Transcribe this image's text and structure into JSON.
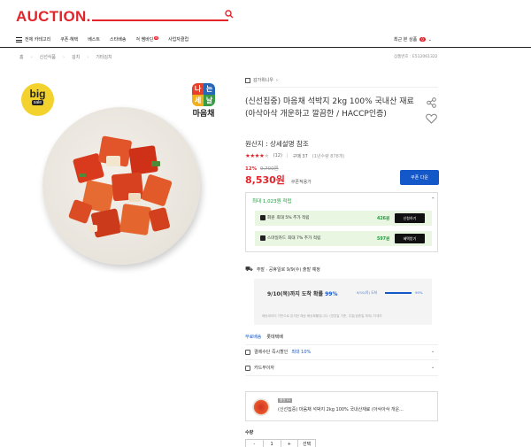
{
  "header": {
    "logo_text": "AUCTION",
    "logo_dot": ".",
    "top_links": [
      "",
      "",
      ""
    ]
  },
  "nav": {
    "items": [
      "전체 카테고리",
      "쿠폰·혜택",
      "베스트",
      "스타배송",
      "걱 쌤바딘",
      "사업자클럽"
    ],
    "new_badge": "N",
    "recent_label": "최근 본 상품",
    "recent_count": "0"
  },
  "breadcrumb": {
    "home": "홈",
    "items": [
      "신선식품",
      "김치",
      "기타김치"
    ],
    "product_no": "상품번호 : E512061322"
  },
  "image": {
    "badge_big": "big",
    "badge_sale": "sale",
    "brand_name": "마음채",
    "brand_chars": [
      "나",
      "는",
      "세",
      "날"
    ],
    "brand_colors": [
      "#e63f2a",
      "#2866b8",
      "#f2b01c",
      "#3a9b45"
    ]
  },
  "product": {
    "store_name": "감가위니우",
    "title": "(신선집중) 마음채 석박지 2kg 100% 국내산 재료 (아삭아삭 개운하고 깔끔한 / HACCP인증)",
    "origin": "원산지 : 상세설명 참조",
    "rating_stars": "★★★★",
    "rating_off": "★",
    "review_count": "(12)",
    "purchase_count": "구매 37",
    "purchase_note": "(1년수량 878개)",
    "discount_rate": "12%",
    "original_price": "9,700원",
    "price": "8,530원",
    "price_tag": "쿠폰적용가",
    "coupon_button": "쿠폰 다운"
  },
  "points": {
    "header": "최대 1,023원 적립",
    "rows": [
      {
        "label_a": "회원",
        "label_b": "최대 5% 추가 적립",
        "value": "426원",
        "button": "신청하기"
      },
      {
        "label_a": "스마일카드",
        "label_b": "최대 7% 추가 적립",
        "value": "597원",
        "button": "혜택받기"
      }
    ]
  },
  "shipping": {
    "header": "주말 · 공휴일로 9/9(수) 출발 예정",
    "arrival_text": "9/10(목)까지 도착 확률",
    "arrival_pct": "99%",
    "bar_label": "9/10(목) 도착",
    "bar_value": "99%",
    "bar_fraction": 0.99,
    "note": "배송데이터 기반으로 분석한 예상 배송확률입니다. (영업일 기준, 주말/공휴일 제외) 자세히",
    "free_label": "무료배송",
    "carrier": "롯데택배"
  },
  "options": {
    "card_discount_label": "결제수단 즉시할인",
    "card_discount_value": "최대 10%",
    "card_installment": "카드무이자",
    "option_tag": "옵션 01",
    "option_name": "(신선집중) 마음채 석박지 2kg 100% 국내산재료 (아삭아삭 개운...",
    "qty_label": "수량",
    "qty_minus": "-",
    "qty_value": "1",
    "qty_plus": "+",
    "qty_extra": "선택"
  }
}
